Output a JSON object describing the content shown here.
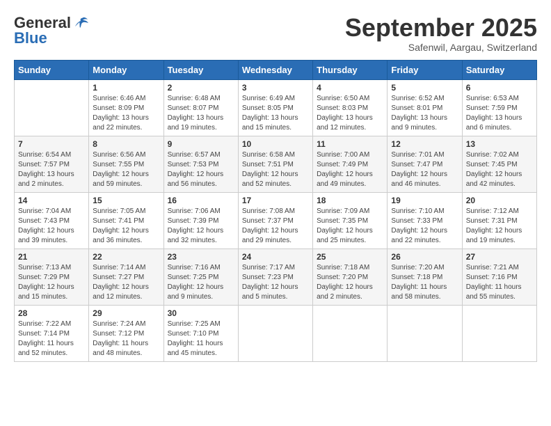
{
  "header": {
    "logo_general": "General",
    "logo_blue": "Blue",
    "month_title": "September 2025",
    "location": "Safenwil, Aargau, Switzerland"
  },
  "columns": [
    "Sunday",
    "Monday",
    "Tuesday",
    "Wednesday",
    "Thursday",
    "Friday",
    "Saturday"
  ],
  "weeks": [
    [
      {
        "day": "",
        "info": ""
      },
      {
        "day": "1",
        "info": "Sunrise: 6:46 AM\nSunset: 8:09 PM\nDaylight: 13 hours\nand 22 minutes."
      },
      {
        "day": "2",
        "info": "Sunrise: 6:48 AM\nSunset: 8:07 PM\nDaylight: 13 hours\nand 19 minutes."
      },
      {
        "day": "3",
        "info": "Sunrise: 6:49 AM\nSunset: 8:05 PM\nDaylight: 13 hours\nand 15 minutes."
      },
      {
        "day": "4",
        "info": "Sunrise: 6:50 AM\nSunset: 8:03 PM\nDaylight: 13 hours\nand 12 minutes."
      },
      {
        "day": "5",
        "info": "Sunrise: 6:52 AM\nSunset: 8:01 PM\nDaylight: 13 hours\nand 9 minutes."
      },
      {
        "day": "6",
        "info": "Sunrise: 6:53 AM\nSunset: 7:59 PM\nDaylight: 13 hours\nand 6 minutes."
      }
    ],
    [
      {
        "day": "7",
        "info": "Sunrise: 6:54 AM\nSunset: 7:57 PM\nDaylight: 13 hours\nand 2 minutes."
      },
      {
        "day": "8",
        "info": "Sunrise: 6:56 AM\nSunset: 7:55 PM\nDaylight: 12 hours\nand 59 minutes."
      },
      {
        "day": "9",
        "info": "Sunrise: 6:57 AM\nSunset: 7:53 PM\nDaylight: 12 hours\nand 56 minutes."
      },
      {
        "day": "10",
        "info": "Sunrise: 6:58 AM\nSunset: 7:51 PM\nDaylight: 12 hours\nand 52 minutes."
      },
      {
        "day": "11",
        "info": "Sunrise: 7:00 AM\nSunset: 7:49 PM\nDaylight: 12 hours\nand 49 minutes."
      },
      {
        "day": "12",
        "info": "Sunrise: 7:01 AM\nSunset: 7:47 PM\nDaylight: 12 hours\nand 46 minutes."
      },
      {
        "day": "13",
        "info": "Sunrise: 7:02 AM\nSunset: 7:45 PM\nDaylight: 12 hours\nand 42 minutes."
      }
    ],
    [
      {
        "day": "14",
        "info": "Sunrise: 7:04 AM\nSunset: 7:43 PM\nDaylight: 12 hours\nand 39 minutes."
      },
      {
        "day": "15",
        "info": "Sunrise: 7:05 AM\nSunset: 7:41 PM\nDaylight: 12 hours\nand 36 minutes."
      },
      {
        "day": "16",
        "info": "Sunrise: 7:06 AM\nSunset: 7:39 PM\nDaylight: 12 hours\nand 32 minutes."
      },
      {
        "day": "17",
        "info": "Sunrise: 7:08 AM\nSunset: 7:37 PM\nDaylight: 12 hours\nand 29 minutes."
      },
      {
        "day": "18",
        "info": "Sunrise: 7:09 AM\nSunset: 7:35 PM\nDaylight: 12 hours\nand 25 minutes."
      },
      {
        "day": "19",
        "info": "Sunrise: 7:10 AM\nSunset: 7:33 PM\nDaylight: 12 hours\nand 22 minutes."
      },
      {
        "day": "20",
        "info": "Sunrise: 7:12 AM\nSunset: 7:31 PM\nDaylight: 12 hours\nand 19 minutes."
      }
    ],
    [
      {
        "day": "21",
        "info": "Sunrise: 7:13 AM\nSunset: 7:29 PM\nDaylight: 12 hours\nand 15 minutes."
      },
      {
        "day": "22",
        "info": "Sunrise: 7:14 AM\nSunset: 7:27 PM\nDaylight: 12 hours\nand 12 minutes."
      },
      {
        "day": "23",
        "info": "Sunrise: 7:16 AM\nSunset: 7:25 PM\nDaylight: 12 hours\nand 9 minutes."
      },
      {
        "day": "24",
        "info": "Sunrise: 7:17 AM\nSunset: 7:23 PM\nDaylight: 12 hours\nand 5 minutes."
      },
      {
        "day": "25",
        "info": "Sunrise: 7:18 AM\nSunset: 7:20 PM\nDaylight: 12 hours\nand 2 minutes."
      },
      {
        "day": "26",
        "info": "Sunrise: 7:20 AM\nSunset: 7:18 PM\nDaylight: 11 hours\nand 58 minutes."
      },
      {
        "day": "27",
        "info": "Sunrise: 7:21 AM\nSunset: 7:16 PM\nDaylight: 11 hours\nand 55 minutes."
      }
    ],
    [
      {
        "day": "28",
        "info": "Sunrise: 7:22 AM\nSunset: 7:14 PM\nDaylight: 11 hours\nand 52 minutes."
      },
      {
        "day": "29",
        "info": "Sunrise: 7:24 AM\nSunset: 7:12 PM\nDaylight: 11 hours\nand 48 minutes."
      },
      {
        "day": "30",
        "info": "Sunrise: 7:25 AM\nSunset: 7:10 PM\nDaylight: 11 hours\nand 45 minutes."
      },
      {
        "day": "",
        "info": ""
      },
      {
        "day": "",
        "info": ""
      },
      {
        "day": "",
        "info": ""
      },
      {
        "day": "",
        "info": ""
      }
    ]
  ]
}
